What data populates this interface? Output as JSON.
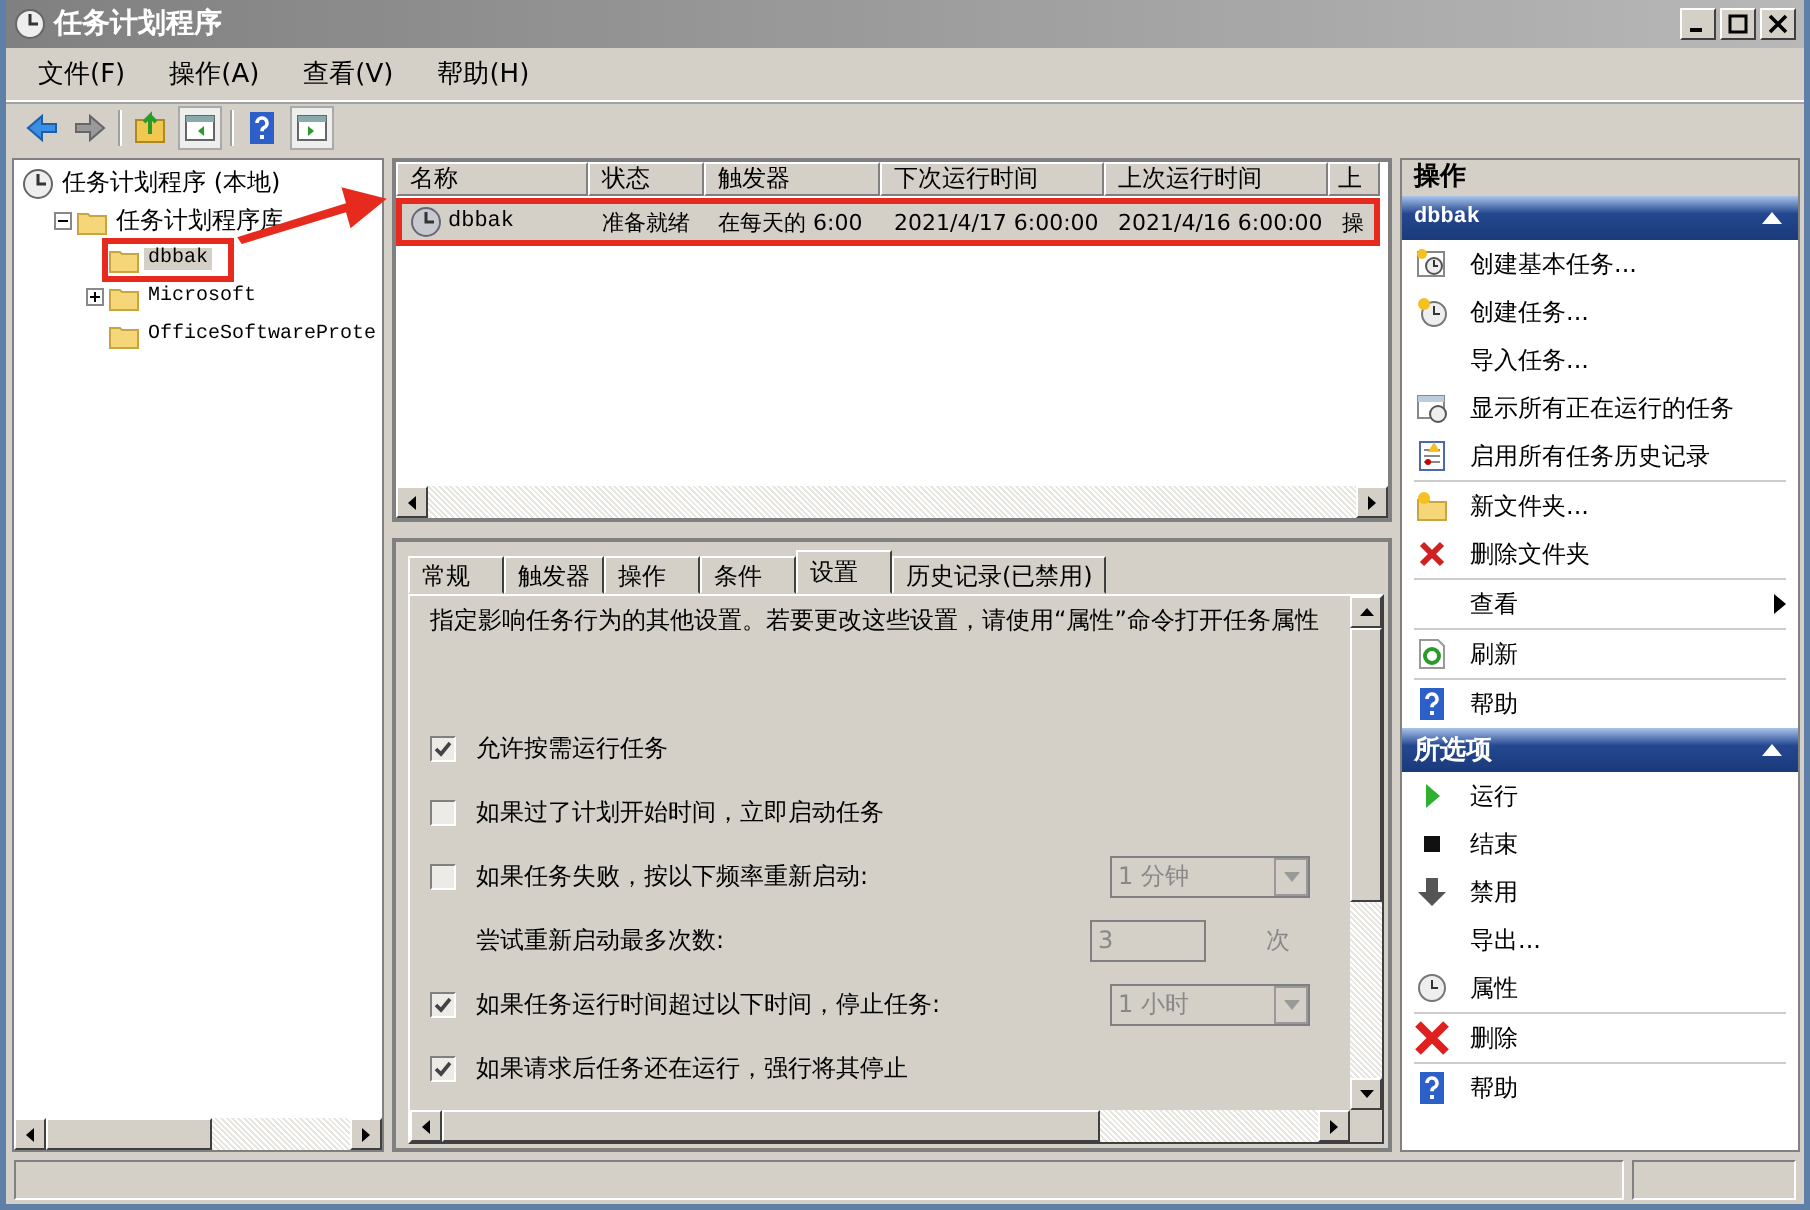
{
  "window": {
    "title": "任务计划程序"
  },
  "menu": [
    "文件(F)",
    "操作(A)",
    "查看(V)",
    "帮助(H)"
  ],
  "tree": [
    {
      "label": "任务计划程序 (本地)",
      "selected": false,
      "children": [
        {
          "label": "任务计划程序库",
          "expanded": true,
          "selected": false,
          "children": [
            {
              "label": "dbbak",
              "selected": true
            },
            {
              "label": "Microsoft",
              "expanded": false,
              "selected": false
            },
            {
              "label": "OfficeSoftwareProte",
              "selected": false
            }
          ]
        }
      ]
    }
  ],
  "task_table": {
    "columns": [
      "名称",
      "状态",
      "触发器",
      "下次运行时间",
      "上次运行时间",
      "上"
    ],
    "rows": [
      {
        "cells": [
          "dbbak",
          "准备就绪",
          "在每天的 6:00",
          "2021/4/17 6:00:00",
          "2021/4/16 6:00:00",
          "操"
        ],
        "selected": true
      }
    ]
  },
  "detail_tabs": [
    {
      "label": "常规",
      "selected": false
    },
    {
      "label": "触发器",
      "selected": false
    },
    {
      "label": "操作",
      "selected": false
    },
    {
      "label": "条件",
      "selected": false
    },
    {
      "label": "设置",
      "selected": true
    },
    {
      "label": "历史记录(已禁用)",
      "selected": false
    }
  ],
  "description": "指定影响任务行为的其他设置。若要更改这些设置，请使用“属性”命令打开任务属性",
  "settings": [
    {
      "kind": "checkbox",
      "label": "允许按需运行任务",
      "checked": true
    },
    {
      "kind": "checkbox",
      "label": "如果过了计划开始时间，立即启动任务",
      "checked": false
    },
    {
      "kind": "checkbox",
      "label": "如果任务失败，按以下频率重新启动:",
      "checked": false,
      "dropdown": "1 分钟"
    },
    {
      "kind": "field",
      "label": "尝试重新启动最多次数:",
      "value": "3",
      "unit": "次"
    },
    {
      "kind": "checkbox",
      "label": "如果任务运行时间超过以下时间，停止任务:",
      "checked": true,
      "dropdown": "1 小时"
    },
    {
      "kind": "checkbox",
      "label": "如果请求后任务还在运行，强行将其停止",
      "checked": true
    }
  ],
  "actions_pane": {
    "title": "操作",
    "sections": [
      {
        "title": "dbbak",
        "expanded": true,
        "items": [
          {
            "label": "创建基本任务...",
            "divider_after": false
          },
          {
            "label": "创建任务...",
            "divider_after": false
          },
          {
            "label": "导入任务...",
            "divider_after": false
          },
          {
            "label": "显示所有正在运行的任务",
            "divider_after": false
          },
          {
            "label": "启用所有任务历史记录",
            "divider_after": true
          },
          {
            "label": "新文件夹...",
            "divider_after": false
          },
          {
            "label": "删除文件夹",
            "divider_after": true
          },
          {
            "label": "查看",
            "divider_after": true,
            "submenu": true
          },
          {
            "label": "刷新",
            "divider_after": true
          },
          {
            "label": "帮助",
            "divider_after": false
          }
        ]
      },
      {
        "title": "所选项",
        "expanded": true,
        "items": [
          {
            "label": "运行",
            "divider_after": false
          },
          {
            "label": "结束",
            "divider_after": false
          },
          {
            "label": "禁用",
            "divider_after": false
          },
          {
            "label": "导出...",
            "divider_after": false
          },
          {
            "label": "属性",
            "divider_after": true
          },
          {
            "label": "删除",
            "divider_after": true
          },
          {
            "label": "帮助",
            "divider_after": false
          }
        ]
      }
    ]
  }
}
